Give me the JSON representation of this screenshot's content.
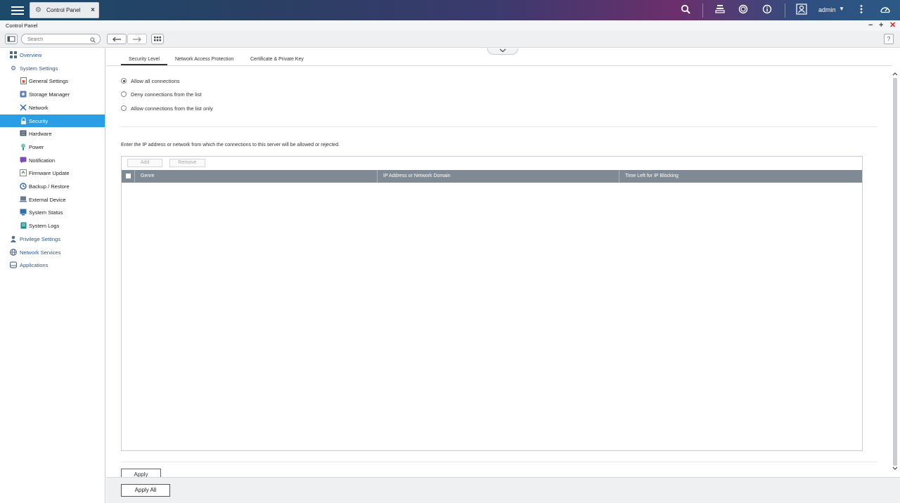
{
  "topbar": {
    "tab_title": "Control Panel",
    "user": "admin",
    "icons": [
      "menu-icon",
      "gear-icon",
      "close-icon",
      "search-icon",
      "stack-icon",
      "sync-icon",
      "info-icon",
      "user-icon",
      "more-icon",
      "dashboard-icon"
    ]
  },
  "window": {
    "title": "Control Panel"
  },
  "toolbar": {
    "search_placeholder": "Search",
    "help_label": "?"
  },
  "sidebar": {
    "items": [
      {
        "label": "Overview",
        "level": "top",
        "icon": "overview-icon"
      },
      {
        "label": "System Settings",
        "level": "top",
        "icon": "settings-icon"
      },
      {
        "label": "General Settings",
        "level": "sub",
        "icon": "general-settings-icon"
      },
      {
        "label": "Storage Manager",
        "level": "sub",
        "icon": "storage-icon"
      },
      {
        "label": "Network",
        "level": "sub",
        "icon": "network-icon"
      },
      {
        "label": "Security",
        "level": "sub",
        "icon": "lock-icon",
        "active": true
      },
      {
        "label": "Hardware",
        "level": "sub",
        "icon": "hardware-icon"
      },
      {
        "label": "Power",
        "level": "sub",
        "icon": "power-icon"
      },
      {
        "label": "Notification",
        "level": "sub",
        "icon": "notification-icon"
      },
      {
        "label": "Firmware Update",
        "level": "sub",
        "icon": "firmware-icon"
      },
      {
        "label": "Backup / Restore",
        "level": "sub",
        "icon": "backup-icon"
      },
      {
        "label": "External Device",
        "level": "sub",
        "icon": "external-device-icon"
      },
      {
        "label": "System Status",
        "level": "sub",
        "icon": "system-status-icon"
      },
      {
        "label": "System Logs",
        "level": "sub",
        "icon": "system-logs-icon"
      },
      {
        "label": "Privilege Settings",
        "level": "top",
        "icon": "privilege-icon"
      },
      {
        "label": "Network Services",
        "level": "top",
        "icon": "network-services-icon"
      },
      {
        "label": "Applications",
        "level": "top",
        "icon": "applications-icon"
      }
    ]
  },
  "main": {
    "tabs": [
      {
        "label": "Security Level",
        "active": true
      },
      {
        "label": "Network Access Protection"
      },
      {
        "label": "Certificate & Private Key"
      }
    ],
    "radios": [
      {
        "label": "Allow all connections",
        "checked": true
      },
      {
        "label": "Deny connections from the list"
      },
      {
        "label": "Allow connections from the list only"
      }
    ],
    "description": "Enter the IP address or network from which the connections to this server will be allowed or rejected.",
    "table": {
      "add_label": "Add",
      "remove_label": "Remove",
      "columns": [
        "Genre",
        "IP Address or Network Domain",
        "Time Left for IP Blocking"
      ]
    },
    "apply_label": "Apply",
    "apply_all_label": "Apply All"
  }
}
